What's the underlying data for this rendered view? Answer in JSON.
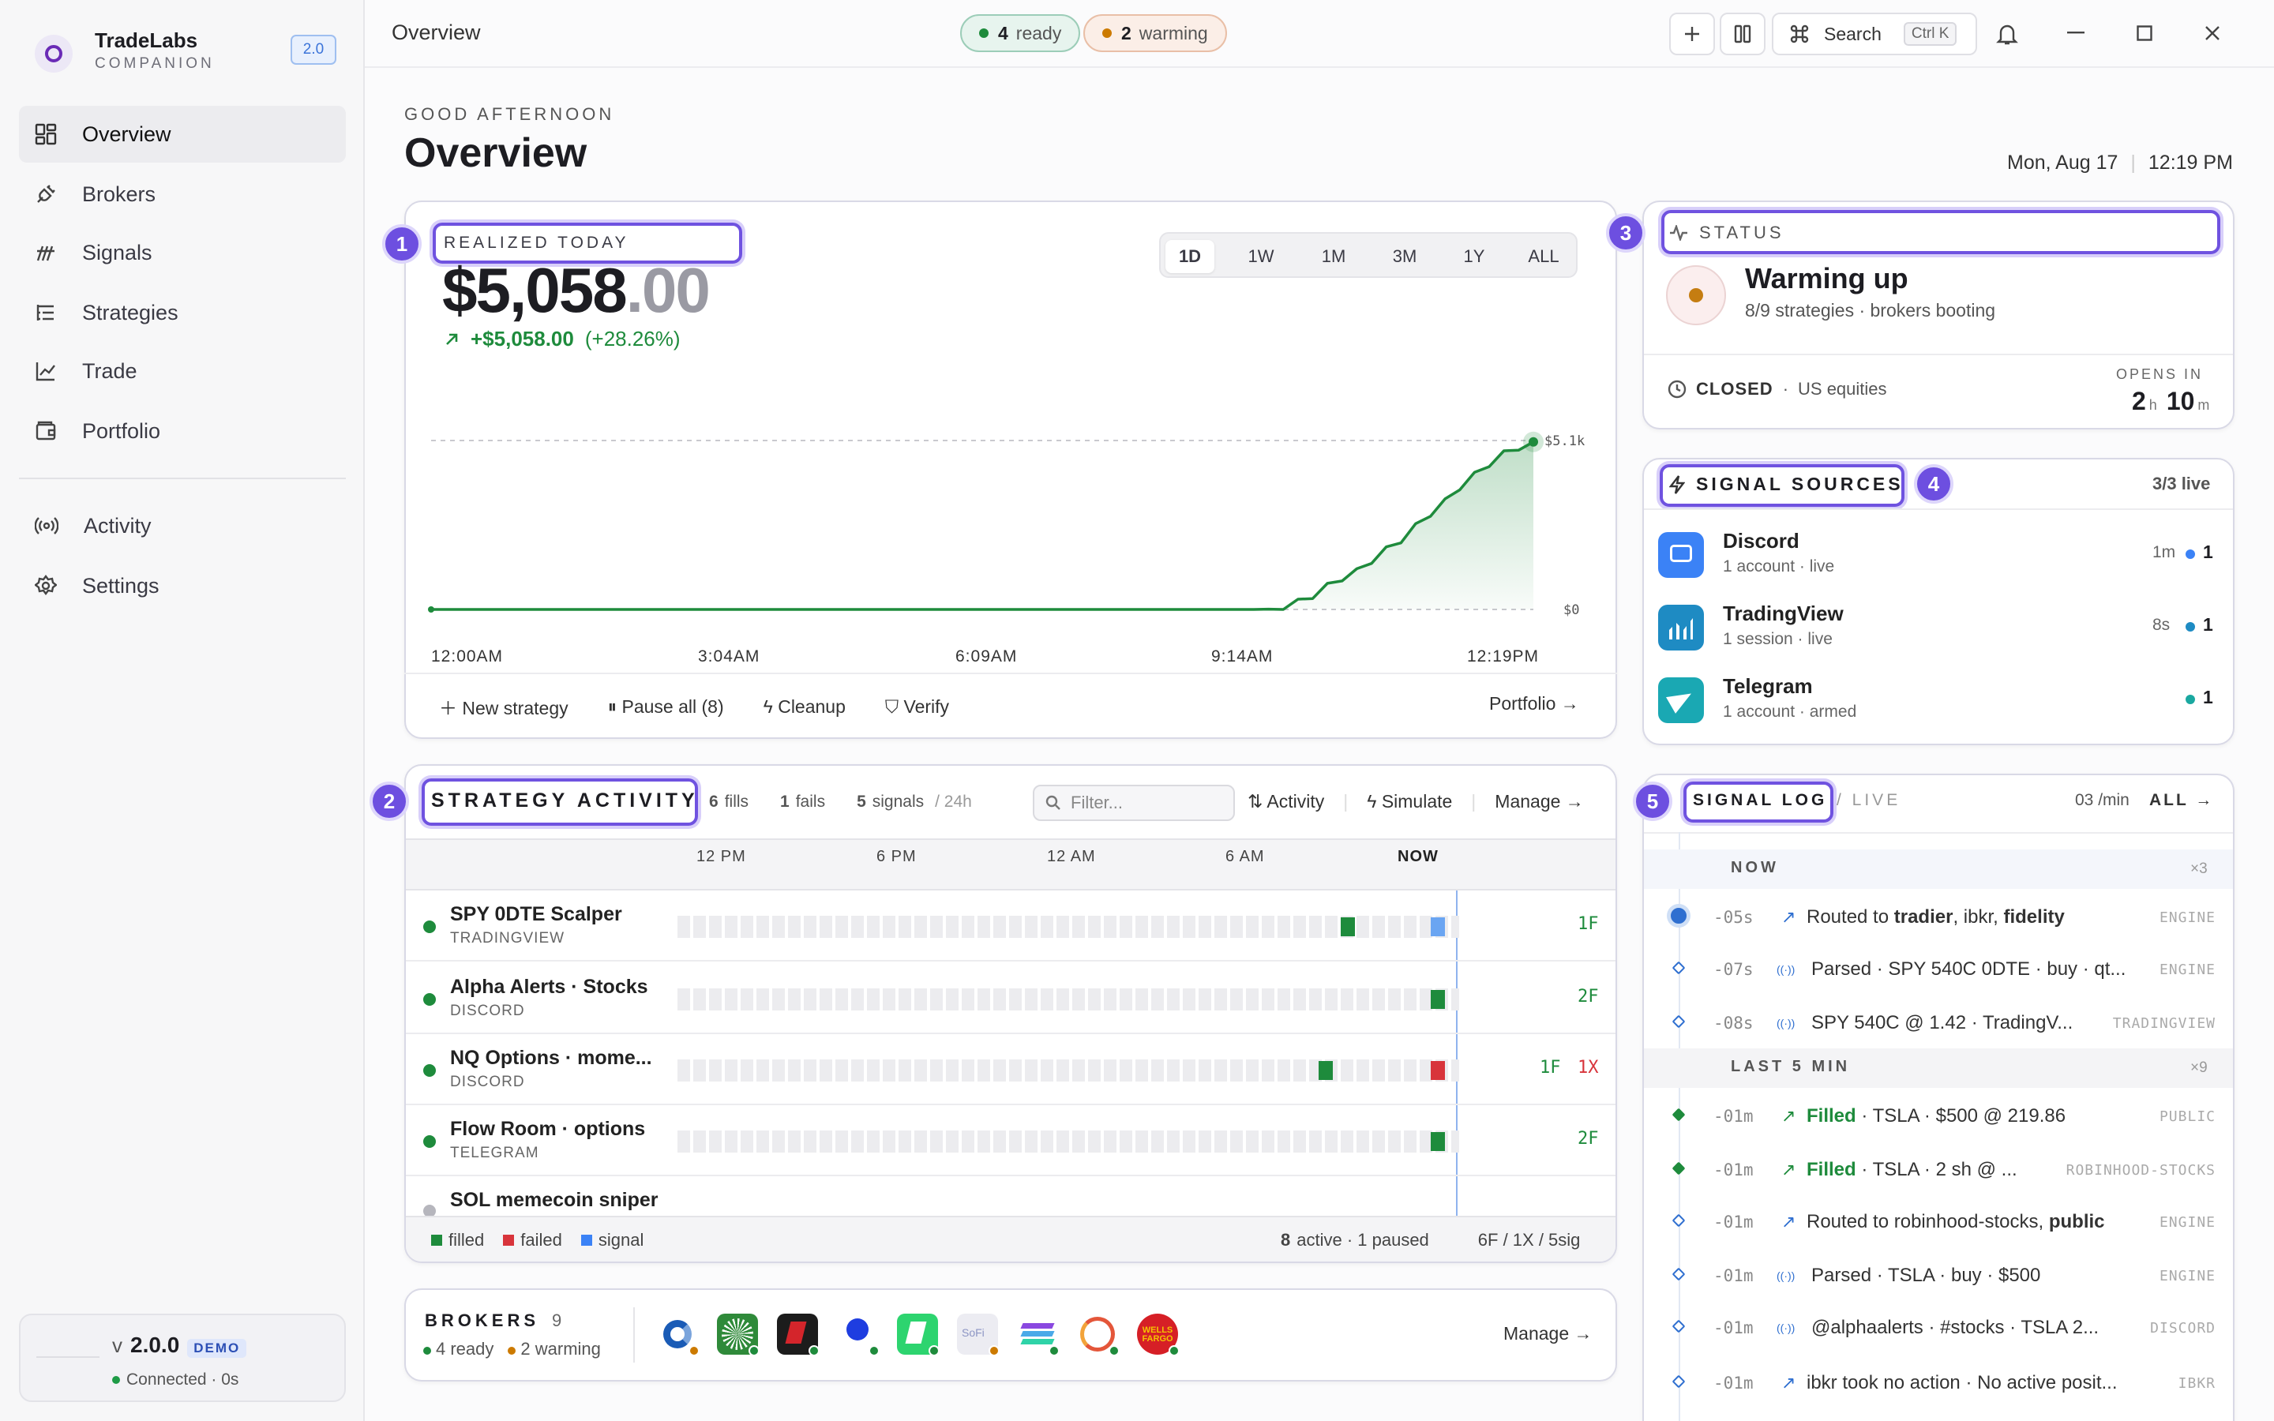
{
  "app": {
    "name": "TradeLabs",
    "subtitle": "COMPANION",
    "version_badge": "2.0"
  },
  "sidebar": {
    "items": [
      {
        "label": "Overview",
        "icon": "grid-icon"
      },
      {
        "label": "Brokers",
        "icon": "plug-icon"
      },
      {
        "label": "Signals",
        "icon": "signal-icon"
      },
      {
        "label": "Strategies",
        "icon": "list-tree-icon"
      },
      {
        "label": "Trade",
        "icon": "line-chart-icon"
      },
      {
        "label": "Portfolio",
        "icon": "wallet-icon"
      },
      {
        "label": "Activity",
        "icon": "broadcast-icon"
      },
      {
        "label": "Settings",
        "icon": "gear-icon"
      }
    ],
    "version": {
      "prefix": "v",
      "number": "2.0.0",
      "tag": "DEMO",
      "status": "Connected · 0s"
    }
  },
  "topbar": {
    "title": "Overview",
    "ready_count": "4",
    "ready_label": "ready",
    "warming_count": "2",
    "warming_label": "warming",
    "search_label": "Search",
    "search_shortcut": "Ctrl K"
  },
  "header": {
    "greeting": "GOOD AFTERNOON",
    "title": "Overview",
    "date": "Mon, Aug 17",
    "time": "12:19 PM"
  },
  "realized": {
    "label": "REALIZED TODAY",
    "dollars": "$5,058",
    "cents": ".00",
    "change": "+$5,058.00",
    "pct": "(+28.26%)",
    "ranges": [
      "1D",
      "1W",
      "1M",
      "3M",
      "1Y",
      "ALL"
    ],
    "selected_range": "1D",
    "actions": {
      "new_strategy": "New strategy",
      "pause_all": "Pause all (8)",
      "cleanup": "Cleanup",
      "verify": "Verify",
      "portfolio": "Portfolio"
    }
  },
  "chart_data": {
    "type": "area",
    "x": [
      "12:00AM",
      "3:04AM",
      "6:09AM",
      "9:14AM",
      "12:19PM"
    ],
    "x_minutes": [
      0,
      120,
      240,
      360,
      480,
      520,
      540,
      560,
      580,
      600,
      620,
      640,
      660,
      680,
      700,
      720,
      739
    ],
    "values": [
      0,
      0,
      0,
      0,
      0,
      0,
      0,
      0,
      0,
      0,
      10,
      80,
      220,
      420,
      700,
      950,
      1140,
      1480,
      1800,
      2100,
      2500,
      2900,
      3250,
      3700,
      4050,
      4400,
      4700,
      4900,
      5058
    ],
    "y_labels": [
      "$5.1k",
      "$0"
    ],
    "ylim": [
      0,
      5100
    ],
    "grid": "dashed at $0 and $5.1k"
  },
  "activity": {
    "title": "STRATEGY ACTIVITY",
    "fills_n": "6",
    "fills": "fills",
    "fails_n": "1",
    "fails": "fails",
    "signals_n": "5",
    "signals": "signals",
    "window": "/ 24h",
    "filter_placeholder": "Filter...",
    "sort_label": "Activity",
    "simulate": "Simulate",
    "manage": "Manage",
    "timeline": [
      "12 PM",
      "6 PM",
      "12 AM",
      "6 AM",
      "NOW"
    ],
    "rows": [
      {
        "name": "SPY 0DTE Scalper",
        "source": "TRADINGVIEW",
        "status": "active",
        "result": "1F",
        "fail": ""
      },
      {
        "name": "Alpha Alerts · Stocks",
        "source": "DISCORD",
        "status": "active",
        "result": "2F",
        "fail": ""
      },
      {
        "name": "NQ Options · mome...",
        "source": "DISCORD",
        "status": "active",
        "result": "1F",
        "fail": "1X"
      },
      {
        "name": "Flow Room · options",
        "source": "TELEGRAM",
        "status": "active",
        "result": "2F",
        "fail": ""
      },
      {
        "name": "SOL memecoin sniper",
        "source": "",
        "status": "paused",
        "result": "",
        "fail": ""
      }
    ],
    "legend": [
      "filled",
      "failed",
      "signal"
    ],
    "legend_colors": [
      "#1e8b3c",
      "#d8343b",
      "#3b82f6"
    ],
    "summary_active": "8",
    "summary_active_label": "active · 1 paused",
    "summary_counts": "6F / 1X / 5sig"
  },
  "brokers": {
    "label": "BROKERS",
    "count": "9",
    "ready": "4 ready",
    "warming": "2 warming",
    "manage": "Manage"
  },
  "status": {
    "label": "STATUS",
    "state": "Warming up",
    "detail": "8/9 strategies · brokers booting",
    "market": "CLOSED",
    "market_detail": "US equities",
    "opens_label": "OPENS IN",
    "hours": "2",
    "h": "h",
    "minutes": "10",
    "m": "m"
  },
  "sources": {
    "label": "SIGNAL SOURCES",
    "live": "3/3 live",
    "items": [
      {
        "name": "Discord",
        "detail": "1 account · live",
        "age": "1m",
        "count": "1",
        "color": "#3b82f6"
      },
      {
        "name": "TradingView",
        "detail": "1 session · live",
        "age": "8s",
        "count": "1",
        "color": "#1e8bc3"
      },
      {
        "name": "Telegram",
        "detail": "1 account · armed",
        "age": "",
        "count": "1",
        "color": "#1aa8b3"
      }
    ]
  },
  "log": {
    "label": "SIGNAL LOG",
    "live": "/ LIVE",
    "rate": "03 /min",
    "filter": "ALL →",
    "group_now": "NOW",
    "group_now_count": "×3",
    "group_5m": "LAST 5 MIN",
    "group_5m_count": "×9",
    "rows": [
      {
        "t": "-05s",
        "text": "Routed to ",
        "b1": "tradier",
        ", ": "",
        "t2": ", ibkr, ",
        "b2": "fidelity",
        "tag": "ENGINE"
      },
      {
        "t": "-07s",
        "text": "Parsed · SPY 540C 0DTE · buy · qt...",
        "tag": "ENGINE"
      },
      {
        "t": "-08s",
        "text": "SPY 540C @ 1.42 · TradingV...",
        "tag": "TRADINGVIEW"
      },
      {
        "t": "-01m",
        "text": "Filled",
        "rest": " · TSLA · $500 @ 219.86",
        "tag": "PUBLIC"
      },
      {
        "t": "-01m",
        "text": "Filled",
        "rest": " · TSLA · 2 sh @ ...",
        "tag": "ROBINHOOD-STOCKS"
      },
      {
        "t": "-01m",
        "text": "Routed to robinhood-stocks, ",
        "b": "public",
        "tag": "ENGINE"
      },
      {
        "t": "-01m",
        "text": "Parsed · TSLA · buy · $500",
        "tag": "ENGINE"
      },
      {
        "t": "-01m",
        "text": "@alphaalerts · #stocks · TSLA 2...",
        "tag": "DISCORD"
      },
      {
        "t": "-01m",
        "text": "ibkr took no action · No active posit...",
        "tag": "IBKR"
      }
    ]
  },
  "annotations": [
    "1",
    "2",
    "3",
    "4",
    "5"
  ]
}
